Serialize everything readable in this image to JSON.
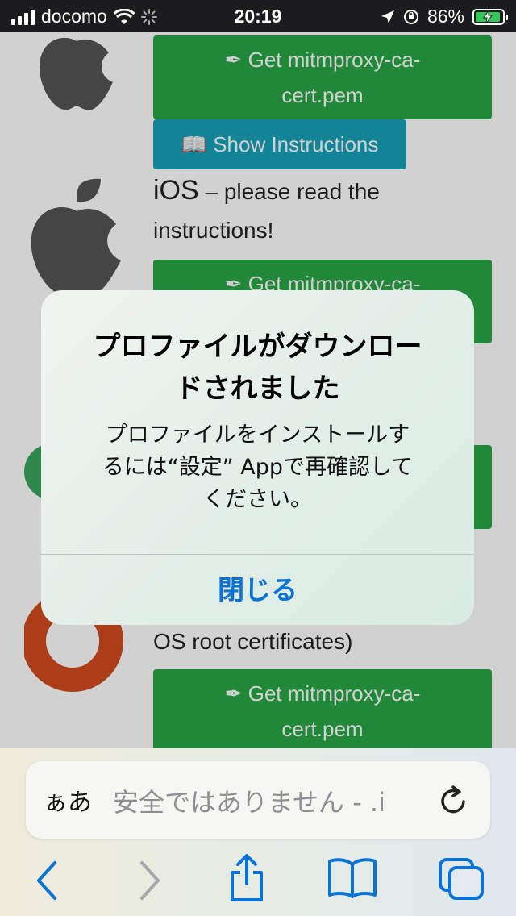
{
  "status_bar": {
    "carrier": "docomo",
    "time": "20:19",
    "battery_percent": "86%"
  },
  "page": {
    "buttons": {
      "get_cert_1_line1": "Get mitmproxy-ca-",
      "get_cert_1_line2": "cert.pem",
      "show_instructions": "Show Instructions",
      "get_cert_2_line1": "Get mitmproxy-ca-",
      "get_cert_3_line1": "Get mitmproxy-ca-",
      "get_cert_3_line2": "cert.pem"
    },
    "ios_heading": "iOS",
    "ios_text_line1": " – please read the",
    "ios_text_line2": "instructions!",
    "android_text_tail": "OS root certificates)",
    "icons": {
      "pen": "pen-icon",
      "book": "book-icon"
    }
  },
  "alert": {
    "title_line1": "プロファイルがダウンロー",
    "title_line2": "ドされました",
    "message_line1": "プロファイルをインストールす",
    "message_line2": "るには“設定” Appで再確認して",
    "message_line3": "ください。",
    "close_button": "閉じる"
  },
  "toolbar": {
    "text_size_button": "ぁあ",
    "address": "安全ではありません - .i",
    "icons": [
      "back-icon",
      "forward-icon",
      "share-icon",
      "bookmarks-icon",
      "tabs-icon",
      "reload-icon"
    ]
  },
  "colors": {
    "green_button": "#28a745",
    "teal_button": "#17a2b8",
    "ios_blue": "#0a74d6"
  }
}
